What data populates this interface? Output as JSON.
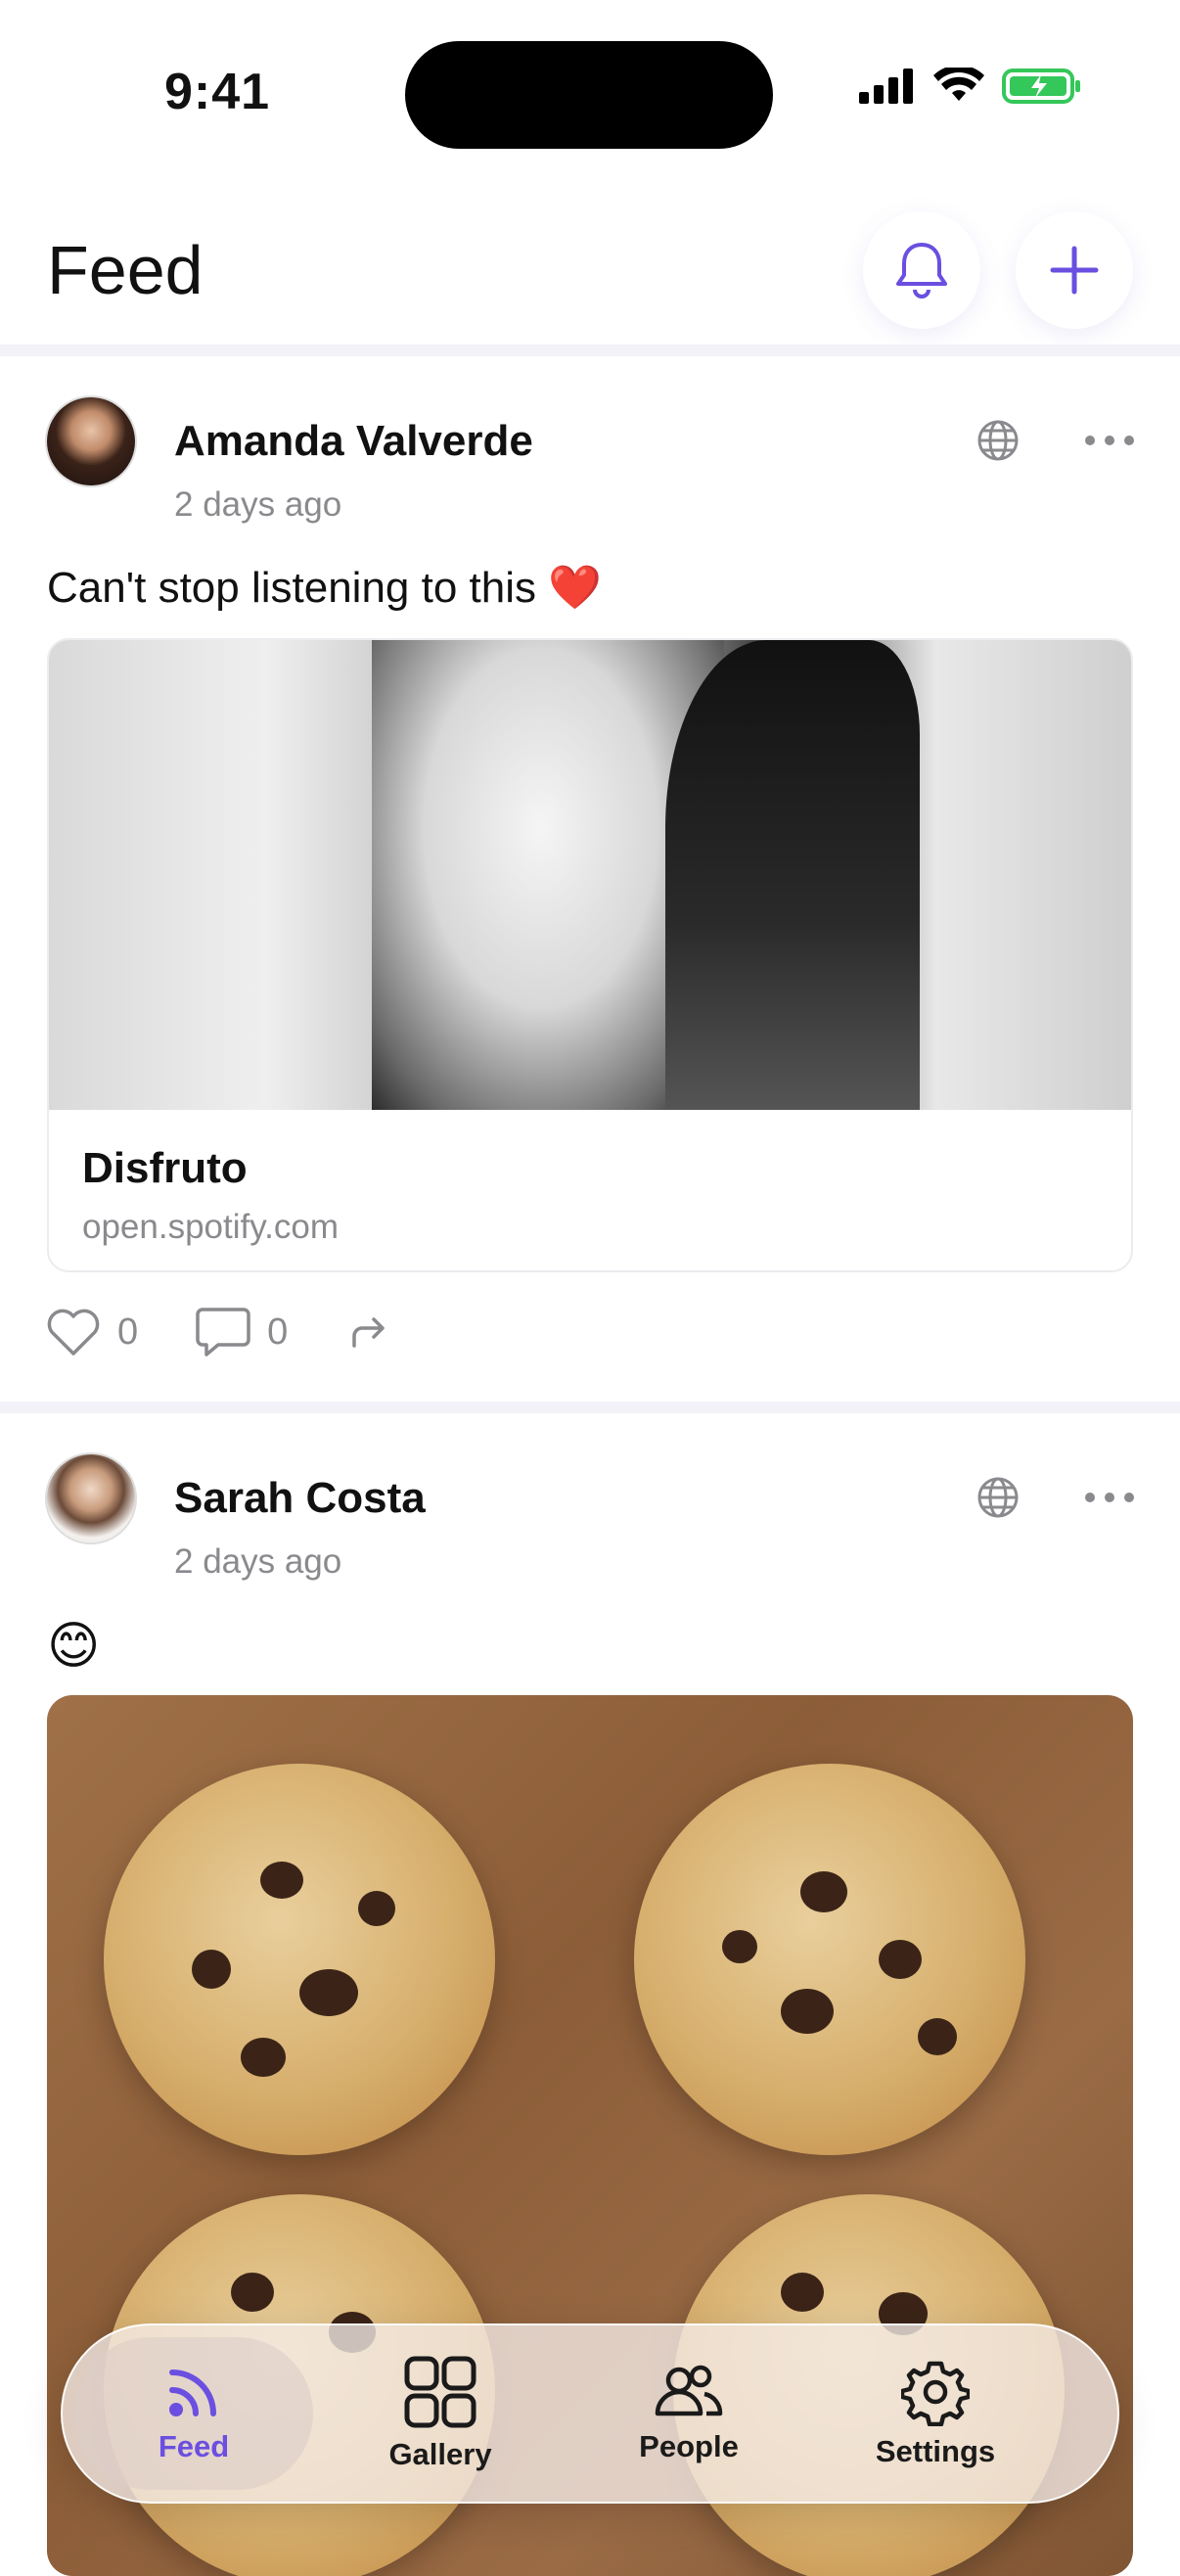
{
  "status_bar": {
    "time": "9:41"
  },
  "header": {
    "title": "Feed",
    "notifications_icon": "bell-icon",
    "add_icon": "plus-icon"
  },
  "accent_color": "#6a4fe0",
  "posts": [
    {
      "author": "Amanda Valverde",
      "time_ago": "2 days ago",
      "text": "Can't stop listening to this ❤️",
      "link_title": "Disfruto",
      "link_domain": "open.spotify.com",
      "likes": "0",
      "comments": "0"
    },
    {
      "author": "Sarah Costa",
      "time_ago": "2 days ago",
      "text": "😊"
    }
  ],
  "tabbar": {
    "items": [
      {
        "label": "Feed",
        "icon": "feed-icon",
        "active": true
      },
      {
        "label": "Gallery",
        "icon": "gallery-icon",
        "active": false
      },
      {
        "label": "People",
        "icon": "people-icon",
        "active": false
      },
      {
        "label": "Settings",
        "icon": "settings-icon",
        "active": false
      }
    ]
  }
}
